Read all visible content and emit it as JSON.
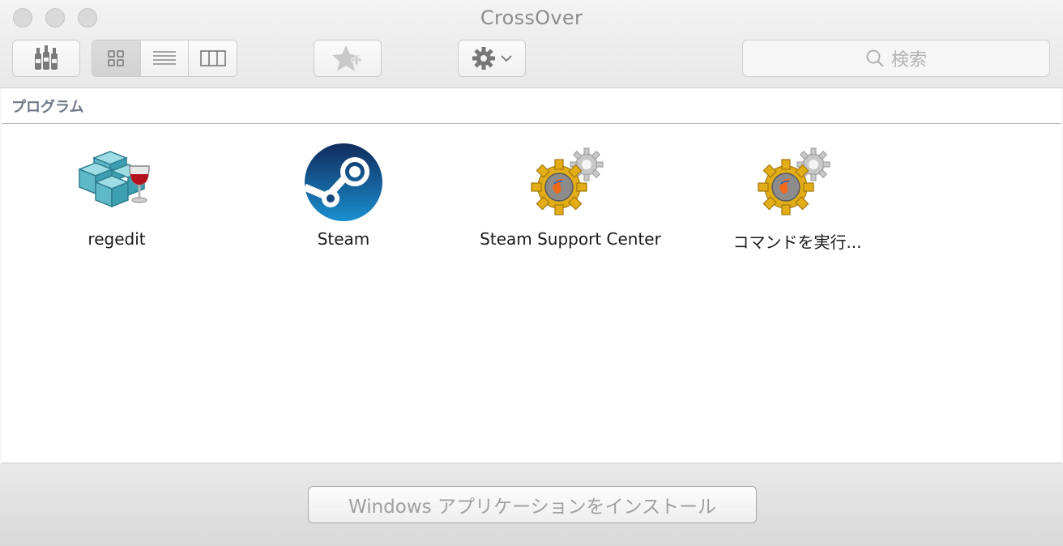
{
  "window": {
    "title": "CrossOver"
  },
  "toolbar": {
    "bottles_icon": "bottles-icon",
    "view_modes": [
      "icon-view",
      "list-view",
      "column-view"
    ],
    "favorite_icon": "star-add-icon",
    "gear_icon": "gear-icon",
    "search_placeholder": "検索"
  },
  "section": {
    "title": "プログラム"
  },
  "apps": [
    {
      "name": "regedit",
      "icon": "regedit-icon"
    },
    {
      "name": "Steam",
      "icon": "steam-icon"
    },
    {
      "name": "Steam Support Center",
      "icon": "wine-gear-icon"
    },
    {
      "name": "コマンドを実行...",
      "icon": "wine-gear-icon"
    }
  ],
  "footer": {
    "install_label": "Windows アプリケーションをインストール"
  },
  "colors": {
    "steam_blue": "#1b3f6e",
    "gear_gold": "#e0a81c",
    "registry_teal": "#4aa6b8"
  }
}
